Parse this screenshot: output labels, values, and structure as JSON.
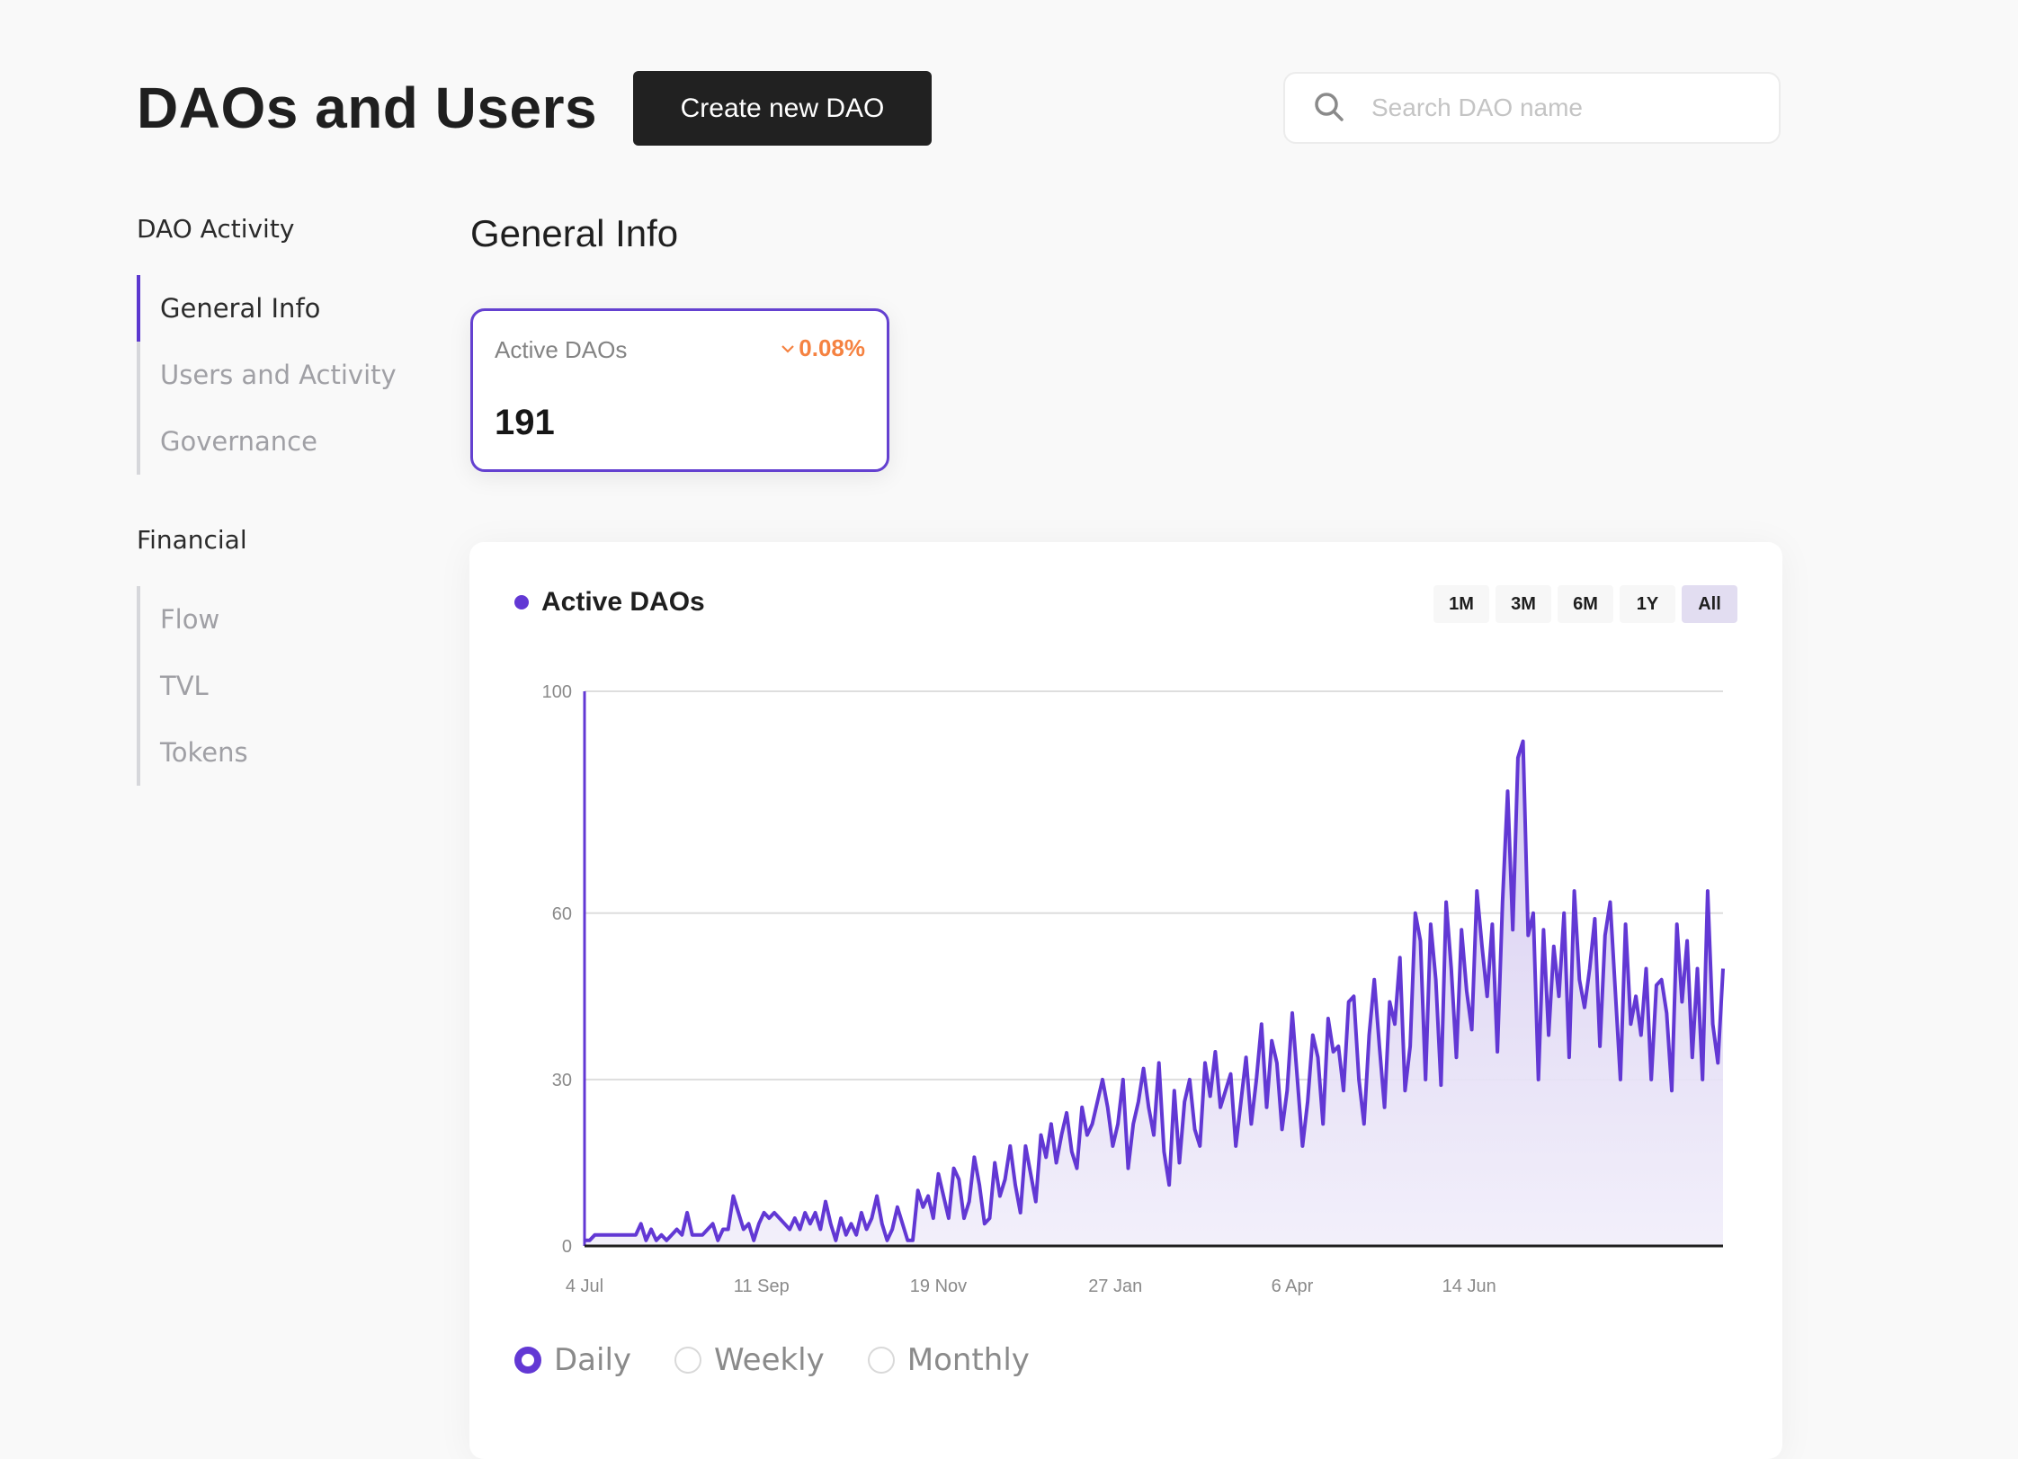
{
  "header": {
    "title": "DAOs and Users",
    "create_button": "Create new DAO",
    "search_placeholder": "Search DAO name",
    "search_value": ""
  },
  "sidebar": {
    "groups": [
      {
        "title": "DAO Activity",
        "items": [
          {
            "label": "General Info",
            "active": true
          },
          {
            "label": "Users and Activity",
            "active": false
          },
          {
            "label": "Governance",
            "active": false
          }
        ]
      },
      {
        "title": "Financial",
        "items": [
          {
            "label": "Flow",
            "active": false
          },
          {
            "label": "TVL",
            "active": false
          },
          {
            "label": "Tokens",
            "active": false
          }
        ]
      }
    ]
  },
  "main": {
    "section_title": "General Info",
    "stat_card": {
      "label": "Active DAOs",
      "change": "0.08%",
      "change_direction": "down",
      "value": "191"
    },
    "chart_card": {
      "title": "Active DAOs",
      "ranges": [
        "1M",
        "3M",
        "6M",
        "1Y",
        "All"
      ],
      "active_range": "All",
      "frequency_options": [
        "Daily",
        "Weekly",
        "Monthly"
      ],
      "active_frequency": "Daily"
    }
  },
  "colors": {
    "accent": "#6238d4",
    "negative": "#f58241",
    "fill": "#e5dff5"
  },
  "chart_data": {
    "type": "area",
    "title": "Active DAOs",
    "xlabel": "",
    "ylabel": "",
    "ylim": [
      0,
      100
    ],
    "yticks": [
      0,
      30,
      60,
      100
    ],
    "xtick_labels": [
      "4 Jul",
      "11 Sep",
      "19 Nov",
      "27 Jan",
      "6 Apr",
      "14 Jun"
    ],
    "xtick_days": [
      0,
      69,
      138,
      207,
      276,
      345
    ],
    "x_step_days": 2,
    "grid": true,
    "legend": "none",
    "series": [
      {
        "name": "Active DAOs",
        "values": [
          1,
          1,
          2,
          2,
          2,
          2,
          2,
          2,
          2,
          2,
          2,
          4,
          1,
          3,
          1,
          2,
          1,
          2,
          3,
          2,
          6,
          2,
          2,
          2,
          3,
          4,
          1,
          3,
          3,
          9,
          6,
          3,
          4,
          1,
          4,
          6,
          5,
          6,
          5,
          4,
          3,
          5,
          3,
          6,
          4,
          6,
          3,
          8,
          4,
          1,
          5,
          2,
          4,
          2,
          6,
          3,
          5,
          9,
          4,
          1,
          3,
          7,
          4,
          1,
          1,
          10,
          7,
          9,
          5,
          13,
          9,
          5,
          14,
          12,
          5,
          8,
          16,
          11,
          4,
          5,
          15,
          9,
          12,
          18,
          11,
          6,
          18,
          13,
          8,
          20,
          16,
          22,
          15,
          20,
          24,
          17,
          14,
          25,
          20,
          22,
          26,
          30,
          25,
          18,
          22,
          30,
          14,
          22,
          26,
          32,
          25,
          20,
          33,
          17,
          11,
          28,
          15,
          26,
          30,
          21,
          18,
          33,
          27,
          35,
          25,
          28,
          31,
          18,
          26,
          34,
          22,
          30,
          40,
          25,
          37,
          33,
          21,
          28,
          42,
          30,
          18,
          26,
          38,
          34,
          22,
          41,
          35,
          36,
          28,
          44,
          45,
          30,
          22,
          38,
          48,
          36,
          25,
          44,
          40,
          52,
          28,
          36,
          60,
          55,
          30,
          58,
          48,
          29,
          62,
          50,
          34,
          57,
          46,
          39,
          64,
          54,
          45,
          58,
          35,
          62,
          82,
          57,
          88,
          91,
          56,
          60,
          30,
          57,
          38,
          54,
          45,
          60,
          34,
          64,
          48,
          43,
          50,
          59,
          36,
          56,
          62,
          46,
          30,
          58,
          40,
          45,
          38,
          50,
          30,
          47,
          48,
          42,
          28,
          58,
          44,
          55,
          34,
          50,
          30,
          64,
          40,
          33,
          50
        ]
      }
    ]
  }
}
